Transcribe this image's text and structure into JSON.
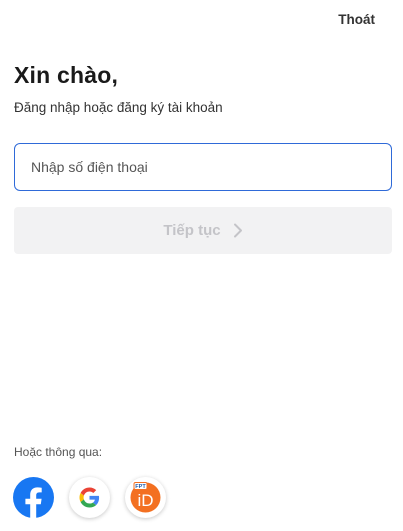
{
  "header": {
    "exit_label": "Thoát"
  },
  "login": {
    "greeting": "Xin chào,",
    "subtitle": "Đăng nhập hoặc đăng ký tài khoản",
    "phone_placeholder": "Nhập số điện thoại",
    "phone_value": "",
    "continue_label": "Tiếp tục"
  },
  "social": {
    "label": "Hoặc thông qua:",
    "providers": [
      {
        "name": "Facebook",
        "icon": "facebook-icon",
        "color": "#1877f2"
      },
      {
        "name": "Google",
        "icon": "google-icon",
        "color": "#4285f4"
      },
      {
        "name": "FPT iD",
        "icon": "fpt-id-icon",
        "color": "#f37021",
        "badge": "FPT"
      }
    ]
  },
  "colors": {
    "input_border": "#2f6ad8",
    "button_disabled_bg": "#f2f2f3",
    "button_disabled_text": "#c4c4c8"
  }
}
